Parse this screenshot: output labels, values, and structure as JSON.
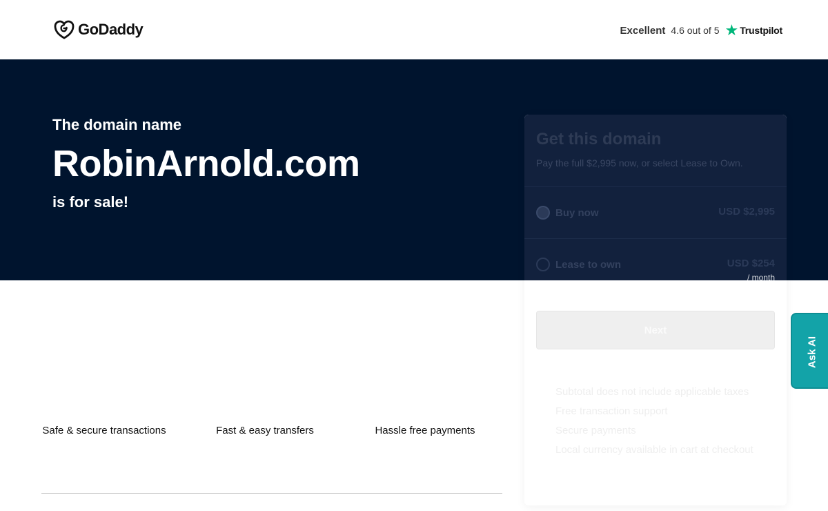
{
  "header": {
    "logo_text": "GoDaddy",
    "rating": {
      "label": "Excellent",
      "score": "4.6 out of 5",
      "provider": "Trustpilot",
      "star_color": "#00b67a"
    }
  },
  "hero": {
    "pre": "The domain name",
    "domain": "RobinArnold.com",
    "post": "is for sale!",
    "background": "#00142e"
  },
  "features": [
    "Safe & secure transactions",
    "Fast & easy transfers",
    "Hassle free payments"
  ],
  "card": {
    "title": "Get this domain",
    "subtitle": "Pay the full $2,995 now, or select Lease to Own.",
    "options": [
      {
        "label": "Buy now",
        "price": "USD $2,995",
        "selected": true
      },
      {
        "label": "Lease to own",
        "price": "USD $254",
        "per": "/ month",
        "selected": false
      }
    ],
    "next_label": "Next",
    "notes": [
      "Subtotal does not include applicable taxes",
      "Free transaction support",
      "Secure payments",
      "Local currency available in cart at checkout"
    ]
  },
  "ask_ai": {
    "label": "Ask AI",
    "color": "#13a3a8"
  }
}
